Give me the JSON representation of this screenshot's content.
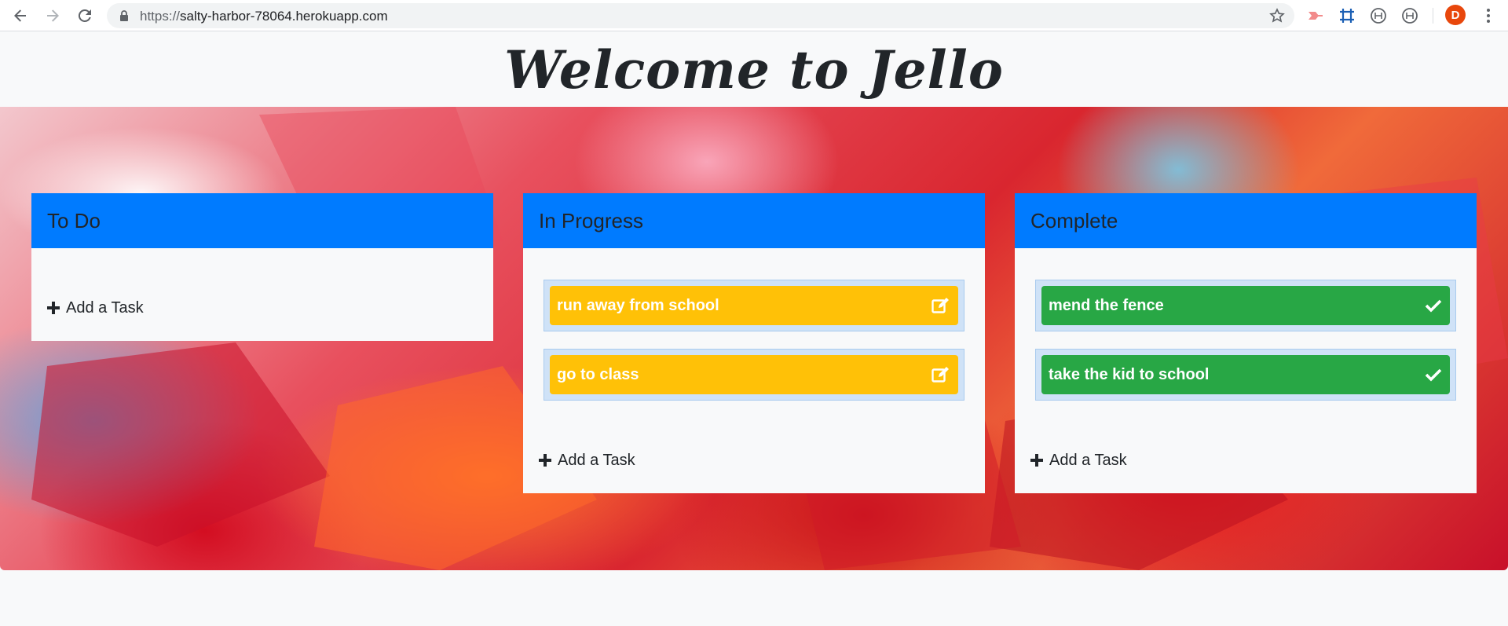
{
  "browser": {
    "url_scheme": "https://",
    "url_host": "salty-harbor-78064.herokuapp.com",
    "profile_initial": "D",
    "icons": [
      "back-icon",
      "forward-icon",
      "reload-icon",
      "lock-icon",
      "star-icon",
      "extension-icon",
      "crop-icon",
      "extension-icon",
      "extension-icon",
      "menu-icon"
    ]
  },
  "header": {
    "title": "Welcome to Jello"
  },
  "colors": {
    "board_header": "#007bff",
    "in_progress_task": "#ffc107",
    "complete_task": "#28a745",
    "task_wrap": "#cfe2f7"
  },
  "boards": [
    {
      "title": "To Do",
      "tasks": [],
      "add_label": "Add a Task"
    },
    {
      "title": "In Progress",
      "tasks": [
        {
          "label": "run away from school",
          "icon": "edit-icon"
        },
        {
          "label": "go to class",
          "icon": "edit-icon"
        }
      ],
      "add_label": "Add a Task"
    },
    {
      "title": "Complete",
      "tasks": [
        {
          "label": "mend the fence",
          "icon": "check-icon"
        },
        {
          "label": "take the kid to school",
          "icon": "check-icon"
        }
      ],
      "add_label": "Add a Task"
    }
  ]
}
